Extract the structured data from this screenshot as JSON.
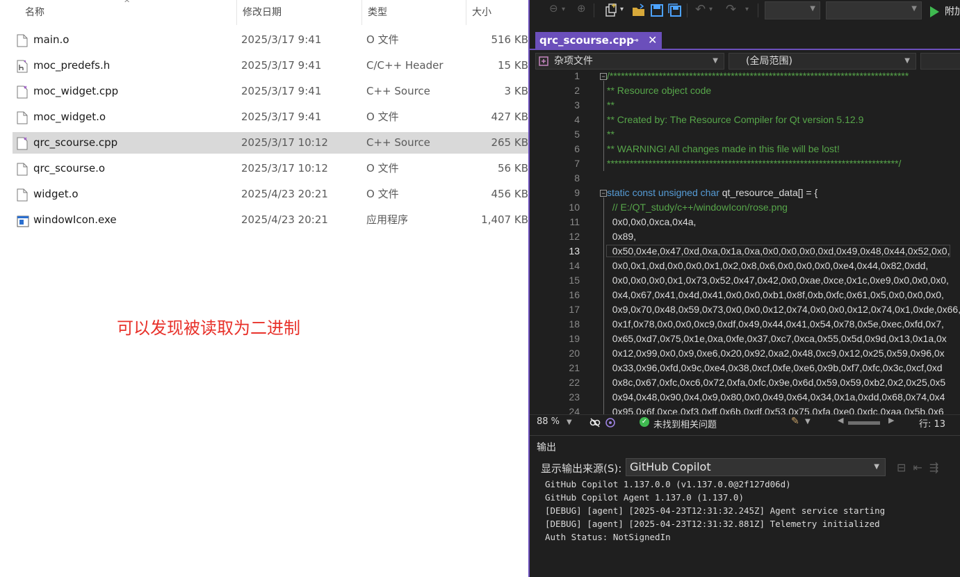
{
  "explorer": {
    "columns": {
      "name": "名称",
      "date": "修改日期",
      "type": "类型",
      "size": "大小"
    },
    "files": [
      {
        "name": "main.o",
        "date": "2025/3/17 9:41",
        "type": "O 文件",
        "size": "516 KB",
        "icon": "file-icon"
      },
      {
        "name": "moc_predefs.h",
        "date": "2025/3/17 9:41",
        "type": "C/C++ Header",
        "size": "15 KB",
        "icon": "header-file-icon"
      },
      {
        "name": "moc_widget.cpp",
        "date": "2025/3/17 9:41",
        "type": "C++ Source",
        "size": "3 KB",
        "icon": "cpp-file-icon"
      },
      {
        "name": "moc_widget.o",
        "date": "2025/3/17 9:41",
        "type": "O 文件",
        "size": "427 KB",
        "icon": "file-icon"
      },
      {
        "name": "qrc_scourse.cpp",
        "date": "2025/3/17 10:12",
        "type": "C++ Source",
        "size": "265 KB",
        "icon": "cpp-file-icon"
      },
      {
        "name": "qrc_scourse.o",
        "date": "2025/3/17 10:12",
        "type": "O 文件",
        "size": "56 KB",
        "icon": "file-icon"
      },
      {
        "name": "widget.o",
        "date": "2025/4/23 20:21",
        "type": "O 文件",
        "size": "456 KB",
        "icon": "file-icon"
      },
      {
        "name": "windowIcon.exe",
        "date": "2025/4/23 20:21",
        "type": "应用程序",
        "size": "1,407 KB",
        "icon": "exe-file-icon"
      }
    ],
    "annotation": "可以发现被读取为二进制"
  },
  "ide": {
    "toolbar": {
      "run_label": "附加"
    },
    "tab": {
      "title": "qrc_scourse.cpp"
    },
    "nav": {
      "project": "杂项文件",
      "scope": "(全局范围)"
    },
    "editor": {
      "lines": [
        {
          "n": "1",
          "text": "/*******************************************************************************"
        },
        {
          "n": "2",
          "text": "** Resource object code"
        },
        {
          "n": "3",
          "text": "**"
        },
        {
          "n": "4",
          "text": "** Created by: The Resource Compiler for Qt version 5.12.9"
        },
        {
          "n": "5",
          "text": "**"
        },
        {
          "n": "6",
          "text": "** WARNING! All changes made in this file will be lost!"
        },
        {
          "n": "7",
          "text": "*****************************************************************************/"
        },
        {
          "n": "8",
          "text": ""
        },
        {
          "n": "9",
          "text": "static const unsigned char qt_resource_data[] = {"
        },
        {
          "n": "10",
          "text": "  // E:/QT_study/c++/windowIcon/rose.png"
        },
        {
          "n": "11",
          "text": "  0x0,0x0,0xca,0x4a,"
        },
        {
          "n": "12",
          "text": "  0x89,"
        },
        {
          "n": "13",
          "text": "  0x50,0x4e,0x47,0xd,0xa,0x1a,0xa,0x0,0x0,0x0,0xd,0x49,0x48,0x44,0x52,0x0,"
        },
        {
          "n": "14",
          "text": "  0x0,0x1,0xd,0x0,0x0,0x1,0x2,0x8,0x6,0x0,0x0,0x0,0xe4,0x44,0x82,0xdd,"
        },
        {
          "n": "15",
          "text": "  0x0,0x0,0x0,0x1,0x73,0x52,0x47,0x42,0x0,0xae,0xce,0x1c,0xe9,0x0,0x0,0x0,"
        },
        {
          "n": "16",
          "text": "  0x4,0x67,0x41,0x4d,0x41,0x0,0x0,0xb1,0x8f,0xb,0xfc,0x61,0x5,0x0,0x0,0x0,"
        },
        {
          "n": "17",
          "text": "  0x9,0x70,0x48,0x59,0x73,0x0,0x0,0x12,0x74,0x0,0x0,0x12,0x74,0x1,0xde,0x66,"
        },
        {
          "n": "18",
          "text": "  0x1f,0x78,0x0,0x0,0xc9,0xdf,0x49,0x44,0x41,0x54,0x78,0x5e,0xec,0xfd,0x7,"
        },
        {
          "n": "19",
          "text": "  0x65,0xd7,0x75,0x1e,0xa,0xfe,0x37,0xc7,0xca,0x55,0x5d,0x9d,0x13,0x1a,0x"
        },
        {
          "n": "20",
          "text": "  0x12,0x99,0x0,0x9,0xe6,0x20,0x92,0xa2,0x48,0xc9,0x12,0x25,0x59,0x96,0x"
        },
        {
          "n": "21",
          "text": "  0x33,0x96,0xfd,0x9c,0xe4,0x38,0xcf,0xfe,0xe6,0x9b,0xf7,0xfc,0x3c,0xcf,0xd"
        },
        {
          "n": "22",
          "text": "  0x8c,0x67,0xfc,0xc6,0x72,0xfa,0xfc,0x9e,0x6d,0x59,0x59,0xb2,0x2,0x25,0x5"
        },
        {
          "n": "23",
          "text": "  0x94,0x48,0x90,0x4,0x9,0x80,0x0,0x49,0x64,0x34,0x1a,0xdd,0x68,0x74,0x4"
        },
        {
          "n": "24",
          "text": "  0x95,0x6f,0xce,0xf3,0xff,0x6b,0xdf,0x53,0x75,0xfa,0xe0,0xdc,0xaa,0x5b,0x6"
        }
      ]
    },
    "status": {
      "zoom": "88 %",
      "issues": "未找到相关问题",
      "row": "行: 13"
    },
    "output": {
      "title": "输出",
      "source_label": "显示输出来源(S):",
      "source_value": "GitHub Copilot",
      "lines": [
        "GitHub Copilot 1.137.0.0 (v1.137.0.0@2f127d06d)",
        "GitHub Copilot Agent 1.137.0 (1.137.0)",
        "[DEBUG] [agent] [2025-04-23T12:31:32.245Z] Agent service starting",
        "[DEBUG] [agent] [2025-04-23T12:31:32.881Z] Telemetry initialized",
        "Auth Status: NotSignedIn"
      ]
    }
  }
}
